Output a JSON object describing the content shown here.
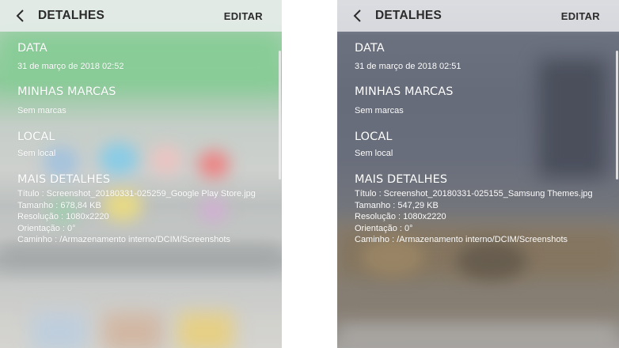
{
  "screens": [
    {
      "header": {
        "title": "DETALHES",
        "edit_label": "EDITAR",
        "back_icon": "chevron-left-icon"
      },
      "sections": {
        "data": {
          "title": "DATA",
          "value": "31 de março de 2018 02:52"
        },
        "marcas": {
          "title": "MINHAS MARCAS",
          "value": "Sem marcas"
        },
        "local": {
          "title": "LOCAL",
          "value": "Sem local"
        },
        "mais": {
          "title": "MAIS DETALHES",
          "lines": [
            "Título : Screenshot_20180331-025259_Google Play Store.jpg",
            "Tamanho : 678,84 KB",
            "Resolução : 1080x2220",
            "Orientação : 0°",
            "Caminho : /Armazenamento interno/DCIM/Screenshots"
          ]
        }
      }
    },
    {
      "header": {
        "title": "DETALHES",
        "edit_label": "EDITAR",
        "back_icon": "chevron-left-icon"
      },
      "sections": {
        "data": {
          "title": "DATA",
          "value": "31 de março de 2018 02:51"
        },
        "marcas": {
          "title": "MINHAS MARCAS",
          "value": "Sem marcas"
        },
        "local": {
          "title": "LOCAL",
          "value": "Sem local"
        },
        "mais": {
          "title": "MAIS DETALHES",
          "lines": [
            "Título : Screenshot_20180331-025155_Samsung Themes.jpg",
            "Tamanho : 547,29 KB",
            "Resolução : 1080x2220",
            "Orientação : 0°",
            "Caminho : /Armazenamento interno/DCIM/Screenshots"
          ]
        }
      }
    }
  ],
  "colors": {
    "text": "#ffffff",
    "header_text": "#2b2b2b",
    "page_background": "#ffffff"
  }
}
